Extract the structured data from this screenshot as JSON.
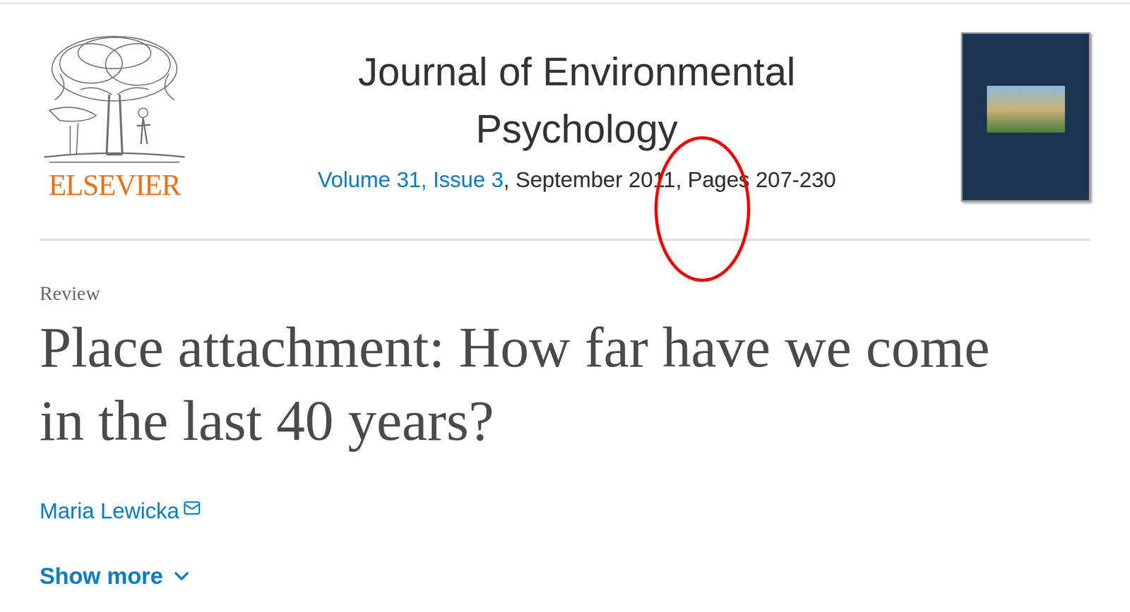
{
  "publisher": {
    "logo_text": "ELSEVIER"
  },
  "journal": {
    "title_lines": [
      "Journal of Environmental",
      "Psychology"
    ],
    "volume_link": "Volume 31, Issue 3",
    "details": ", September 2011, Pages 207-230"
  },
  "article": {
    "type": "Review",
    "title": "Place attachment: How far have we come in the last 40 years?",
    "authors": [
      {
        "name": "Maria Lewicka",
        "has_email": true
      }
    ]
  },
  "show_more": {
    "label": "Show more",
    "expanded": false
  }
}
